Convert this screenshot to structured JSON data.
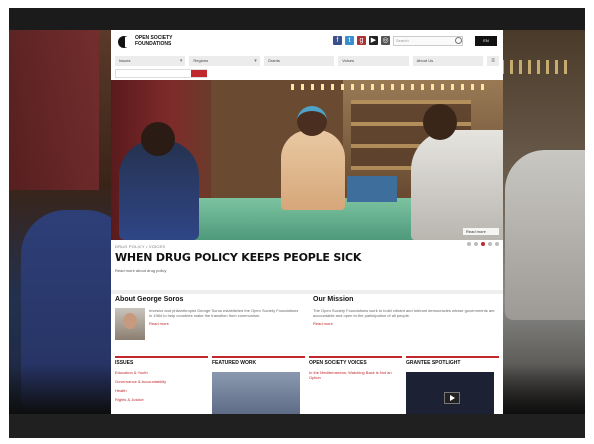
{
  "header": {
    "logo_text": "OPEN SOCIETY FOUNDATIONS",
    "social": [
      "facebook-icon",
      "twitter-icon",
      "google-plus-icon",
      "youtube-icon",
      "instagram-icon"
    ],
    "search_placeholder": "Search",
    "lang_label": "EN"
  },
  "nav": {
    "items": [
      {
        "label": "Issues"
      },
      {
        "label": "Regions"
      },
      {
        "label": "Grants"
      },
      {
        "label": "Voices"
      },
      {
        "label": "About Us"
      }
    ]
  },
  "hero": {
    "caption": "Read more",
    "kicker": "DRUG POLICY • VOICES",
    "headline": "WHEN DRUG POLICY KEEPS PEOPLE SICK",
    "sub": "Read more about drug policy"
  },
  "about": {
    "title": "About George Soros",
    "body": "Investor and philanthropist George Soros established the Open Society Foundations in 1984 to help countries make the transition from communism.",
    "more": "Read more"
  },
  "mission": {
    "title": "Our Mission",
    "body": "The Open Society Foundations work to build vibrant and tolerant democracies whose governments are accountable and open to the participation of all people.",
    "more": "Read more"
  },
  "columns": [
    {
      "title": "ISSUES",
      "links": [
        "Education & Youth",
        "Governance & Accountability",
        "Health",
        "Rights & Justice"
      ]
    },
    {
      "title": "FEATURED WORK"
    },
    {
      "title": "OPEN SOCIETY VOICES",
      "links": [
        "In the Mediterranean, Watching Back is Not an Option"
      ]
    },
    {
      "title": "GRANTEE SPOTLIGHT"
    }
  ],
  "colors": {
    "accent": "#c0282d",
    "text": "#111111"
  }
}
